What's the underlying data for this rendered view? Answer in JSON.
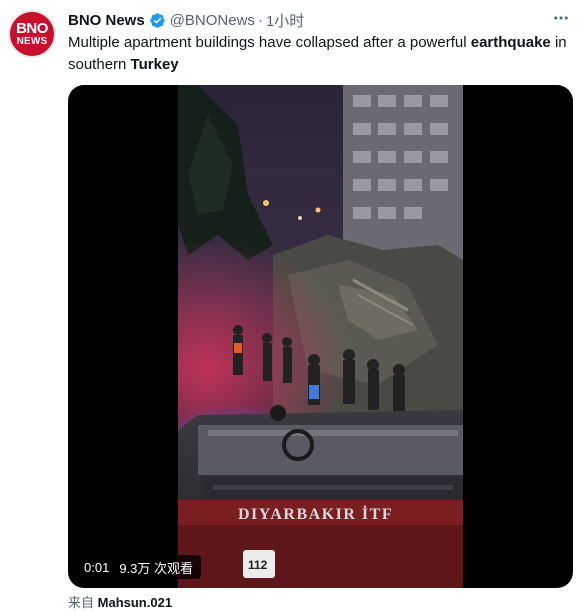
{
  "author": {
    "avatar_line1": "BNO",
    "avatar_line2": "NEWS",
    "name": "BNO News",
    "handle": "@BNONews",
    "separator": "·",
    "time": "1小时",
    "verified": true
  },
  "tweet": {
    "text_segments": [
      {
        "text": "Multiple apartment buildings have collapsed after a powerful ",
        "bold": false
      },
      {
        "text": "earthquake",
        "bold": true
      },
      {
        "text": " in southern ",
        "bold": false
      },
      {
        "text": "Turkey",
        "bold": true
      }
    ]
  },
  "video": {
    "timestamp": "0:01",
    "views": "9.3万 次观看",
    "truck_text": "DIYARBAKIR İTF",
    "truck_plate": "112"
  },
  "source": {
    "prefix": "来自",
    "account": "Mahsun.021"
  },
  "icons": {
    "verified": "verified-badge-icon",
    "more": "more-options-icon"
  },
  "colors": {
    "brand_red": "#c8102e",
    "verified_blue": "#1d9bf0",
    "secondary_text": "#536471"
  }
}
